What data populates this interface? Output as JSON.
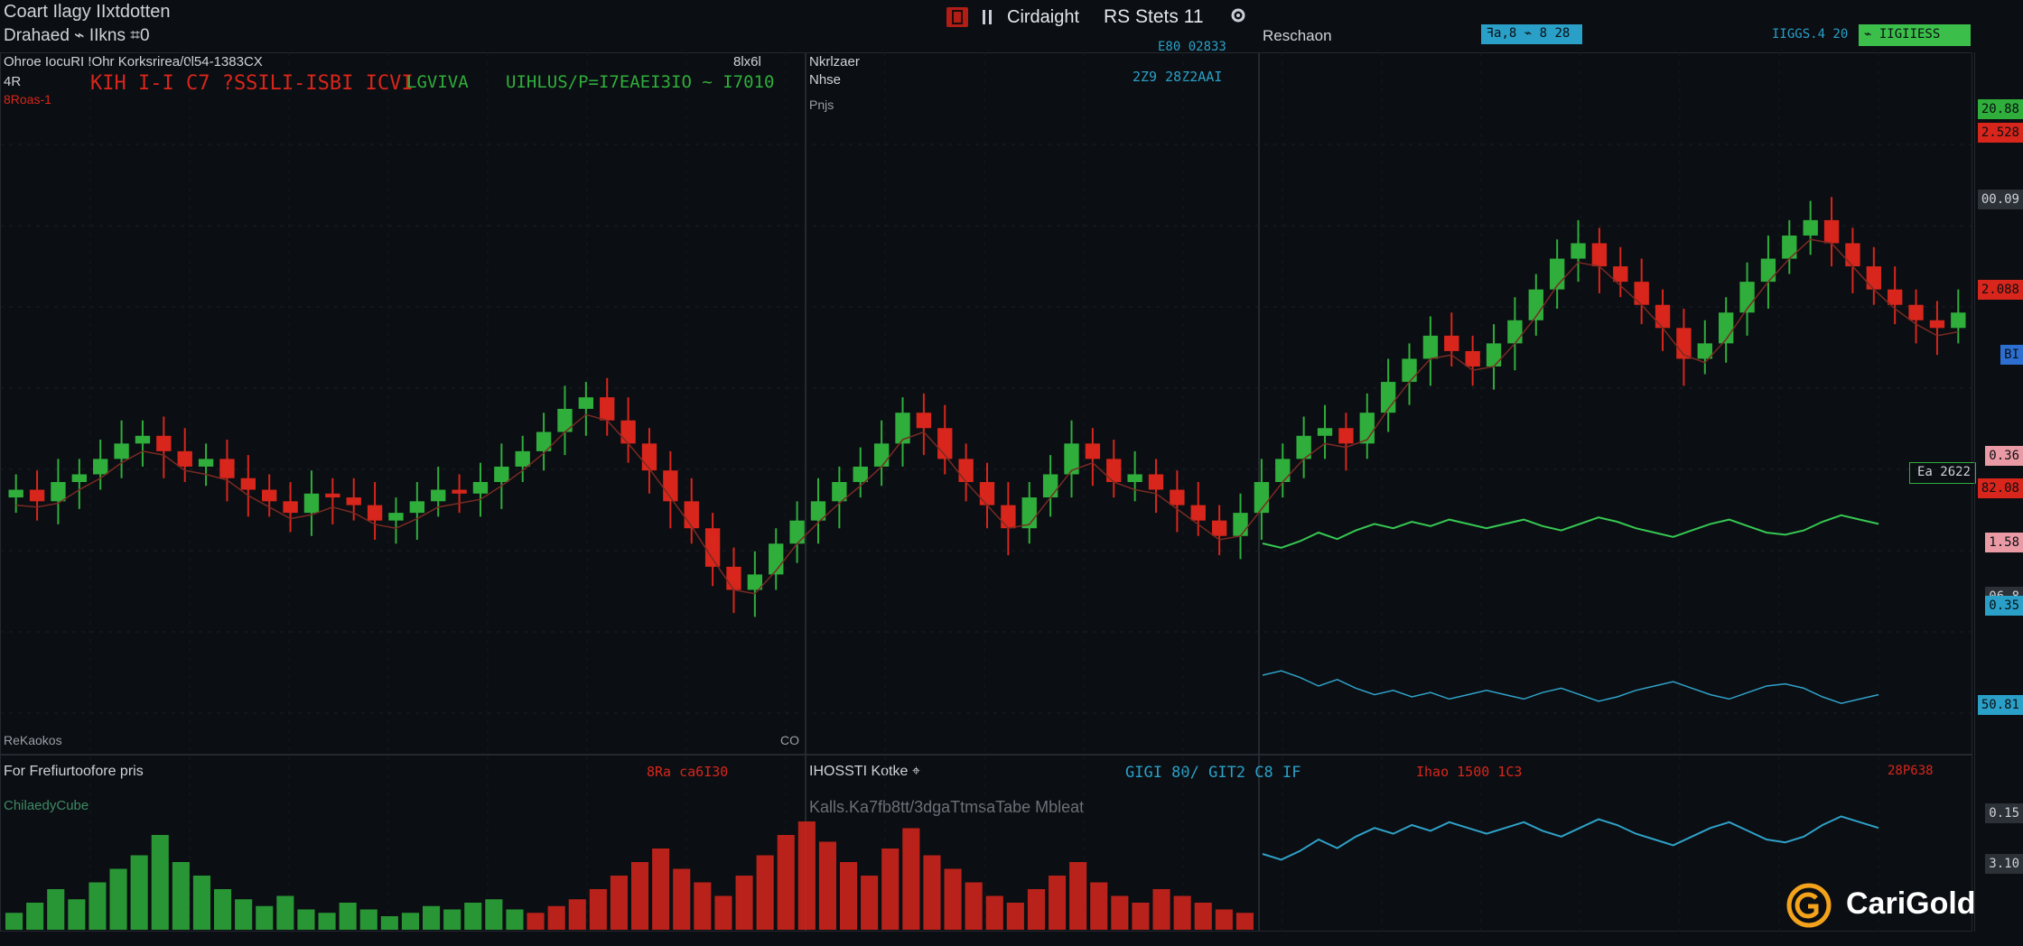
{
  "header": {
    "title_line1": "Coart Ilagy IIxtdotten",
    "title_line2": "Drahaed ⌁ IIkns ⌗0",
    "tools_label": "Cirdaight",
    "tools_label2": "RS Stets 11",
    "right_label": "Reschaon",
    "badge_blue": "ꟻa,8 ⌁ 8 28",
    "badge_right_text": "IIGGS.4 20",
    "badge_green": "⌁ IIGIIESS"
  },
  "panels": {
    "p1_title": "Ohroe IocuRI IOhr Korksrirea/0l54-1383CX",
    "p1_right": "8lx6l",
    "p1_sub": "4R",
    "p1_sub2": "8Roas-1",
    "p1_ticker_red": "KIH I-I C7 ?SSILI-ISBI ICVI",
    "p1_ticker_green": "LGVIVA",
    "p1_ticker_green2": "UIHLUS/P=I7EAEI3IO ~ I7010",
    "p1_bottom": "ReKaokos",
    "p1_bottom_right": "CO",
    "p2_title": "Nkrlzaer",
    "p2_sub": "Nhse",
    "p2_sub2": "Pnjs",
    "p2_top_right": "E80 02833",
    "p2_top_right2": "2Z9 28Z2AAI",
    "p3_tag_dark": "Ea 2622",
    "vol1_title": "For Frefiurtoofore pris",
    "vol1_sub": "ChilaedyCube",
    "vol1_right": "8Ra ca6I30",
    "vol2_title": "IHOSSTI Kotke ⌖",
    "vol2_sub": "Kalls.Ka7fb8tt/3dgaTtmsaTabe Mbleat",
    "vol3_title": "GIGI 80/ GIT2 C8 IF",
    "vol3_mid": "Ihao 1500 1C3",
    "vol3_right": "28P638",
    "watermark": "CariGold"
  },
  "price_axis": [
    "20.88",
    "2.528",
    "00.09",
    "2.088",
    "BI",
    "0.36",
    "82.08",
    "1.58",
    "06.8",
    "0.35",
    "50.81",
    "0.15",
    "3.10"
  ],
  "colors": {
    "up": "#2fae3c",
    "down": "#d8261c",
    "line_green": "#36c853",
    "line_cyan": "#2fa2c9",
    "tag_red": "#d8261c",
    "tag_green": "#2fae3c",
    "tag_blue": "#2d6fd1",
    "tag_pink": "#e99aa5",
    "tag_cyan": "#2aa0c8",
    "badge_green": "#3bbf4a",
    "badge_blue": "#2aa0c8"
  },
  "icons": [
    "alert-icon",
    "pause-icon",
    "settings-icon",
    "coin-logo-icon"
  ],
  "chart_data": [
    {
      "type": "candlestick",
      "title": "",
      "description_series": "price",
      "values": [
        58,
        55,
        60,
        62,
        66,
        70,
        72,
        68,
        64,
        66,
        61,
        58,
        55,
        52,
        57,
        56,
        54,
        50,
        52,
        55,
        58,
        57,
        60,
        64,
        68,
        73,
        79,
        82,
        76,
        70,
        63,
        55,
        48,
        38,
        32,
        36,
        44,
        50,
        55,
        60,
        64,
        70,
        78,
        74,
        66,
        60,
        54,
        48,
        56,
        62,
        70,
        66,
        60,
        62,
        58,
        54,
        50,
        46,
        52,
        60,
        66,
        72,
        74,
        70,
        78,
        86,
        92,
        98,
        94,
        90,
        96,
        102,
        110,
        118,
        122,
        116,
        112,
        106,
        100,
        92,
        96,
        104,
        112,
        118,
        124,
        128,
        122,
        116,
        110,
        106,
        102,
        100,
        104
      ],
      "ylim": [
        0,
        150
      ]
    },
    {
      "type": "line",
      "title": "",
      "values": [
        40,
        36,
        42,
        50,
        44,
        52,
        58,
        54,
        60,
        56,
        62,
        58,
        54,
        58,
        62,
        56,
        52,
        58,
        64,
        60,
        54,
        50,
        46,
        52,
        58,
        62,
        56,
        50,
        48,
        52,
        60,
        66,
        62,
        58
      ],
      "ylim": [
        0,
        100
      ]
    },
    {
      "type": "bar",
      "title": "",
      "values": [
        5,
        8,
        12,
        9,
        14,
        18,
        22,
        28,
        20,
        16,
        12,
        9,
        7,
        10,
        6,
        5,
        8,
        6,
        4,
        5,
        7,
        6,
        8,
        9,
        6,
        5,
        7,
        9,
        12,
        16,
        20,
        24,
        18,
        14,
        10,
        16,
        22,
        28,
        32,
        26,
        20,
        16,
        24,
        30,
        22,
        18,
        14,
        10,
        8,
        12,
        16,
        20,
        14,
        10,
        8,
        12,
        10,
        8,
        6,
        5
      ],
      "ylim": [
        0,
        40
      ]
    }
  ]
}
